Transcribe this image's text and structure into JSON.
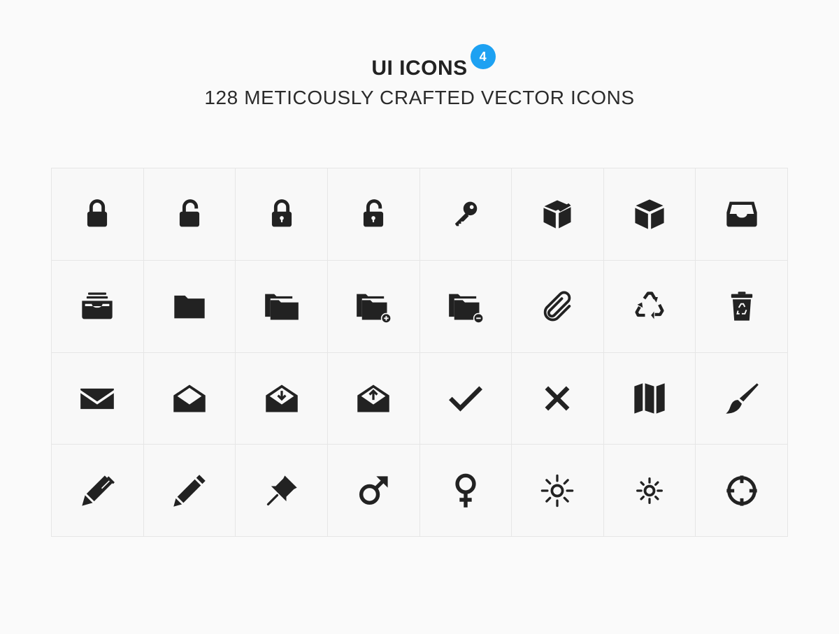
{
  "header": {
    "title": "UI ICONS",
    "badge": "4",
    "subtitle": "128 METICOUSLY CRAFTED VECTOR ICONS"
  },
  "colors": {
    "background": "#fafafa",
    "icon": "#222222",
    "grid_line": "#e6e6e6",
    "badge": "#1da1f2"
  },
  "icons": [
    "lock-icon",
    "unlock-icon",
    "padlock-keyhole-icon",
    "unlock-keyhole-icon",
    "key-icon",
    "box-open-icon",
    "box-icon",
    "inbox-tray-icon",
    "archive-icon",
    "folder-icon",
    "folders-icon",
    "folder-add-icon",
    "folder-remove-icon",
    "paperclip-icon",
    "recycle-icon",
    "trash-recycle-icon",
    "envelope-icon",
    "envelope-open-icon",
    "envelope-download-icon",
    "envelope-upload-icon",
    "checkmark-icon",
    "close-icon",
    "map-icon",
    "paintbrush-icon",
    "pen-icon",
    "pencil-icon",
    "pushpin-icon",
    "male-icon",
    "female-icon",
    "sun-large-icon",
    "sun-small-icon",
    "crosshair-icon"
  ]
}
